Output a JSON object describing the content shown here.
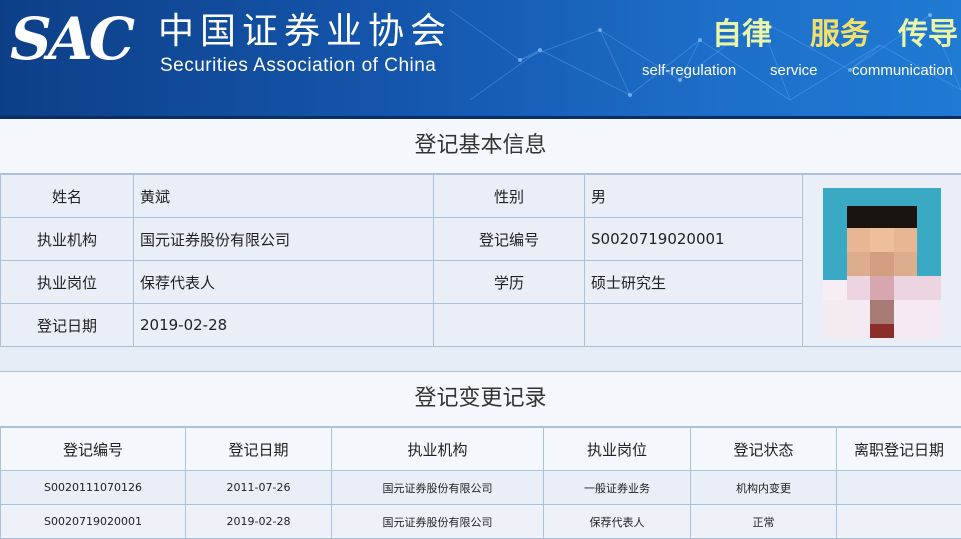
{
  "header": {
    "logo_text": "SAC",
    "org_name_cn": "中国证券业协会",
    "org_name_en": "Securities Association of China",
    "slogans": [
      {
        "cn": "自律",
        "en": "self-regulation"
      },
      {
        "cn": "服务",
        "en": "service"
      },
      {
        "cn": "传导",
        "en": "communication"
      }
    ]
  },
  "basic_info": {
    "title": "登记基本信息",
    "name_label": "姓名",
    "name_value": "黄斌",
    "gender_label": "性别",
    "gender_value": "男",
    "org_label": "执业机构",
    "org_value": "国元证券股份有限公司",
    "reg_no_label": "登记编号",
    "reg_no_value": "S0020719020001",
    "position_label": "执业岗位",
    "position_value": "保荐代表人",
    "education_label": "学历",
    "education_value": "硕士研究生",
    "reg_date_label": "登记日期",
    "reg_date_value": "2019-02-28"
  },
  "change_records": {
    "title": "登记变更记录",
    "headers": [
      "登记编号",
      "登记日期",
      "执业机构",
      "执业岗位",
      "登记状态",
      "离职登记日期"
    ],
    "rows": [
      [
        "S0020111070126",
        "2011-07-26",
        "国元证券股份有限公司",
        "一般证券业务",
        "机构内变更",
        ""
      ],
      [
        "S0020719020001",
        "2019-02-28",
        "国元证券股份有限公司",
        "保荐代表人",
        "正常",
        ""
      ]
    ]
  },
  "colors": {
    "banner_blue": "#1558b0",
    "border": "#a9c2dd",
    "cell_bg": "#e9eef7"
  }
}
